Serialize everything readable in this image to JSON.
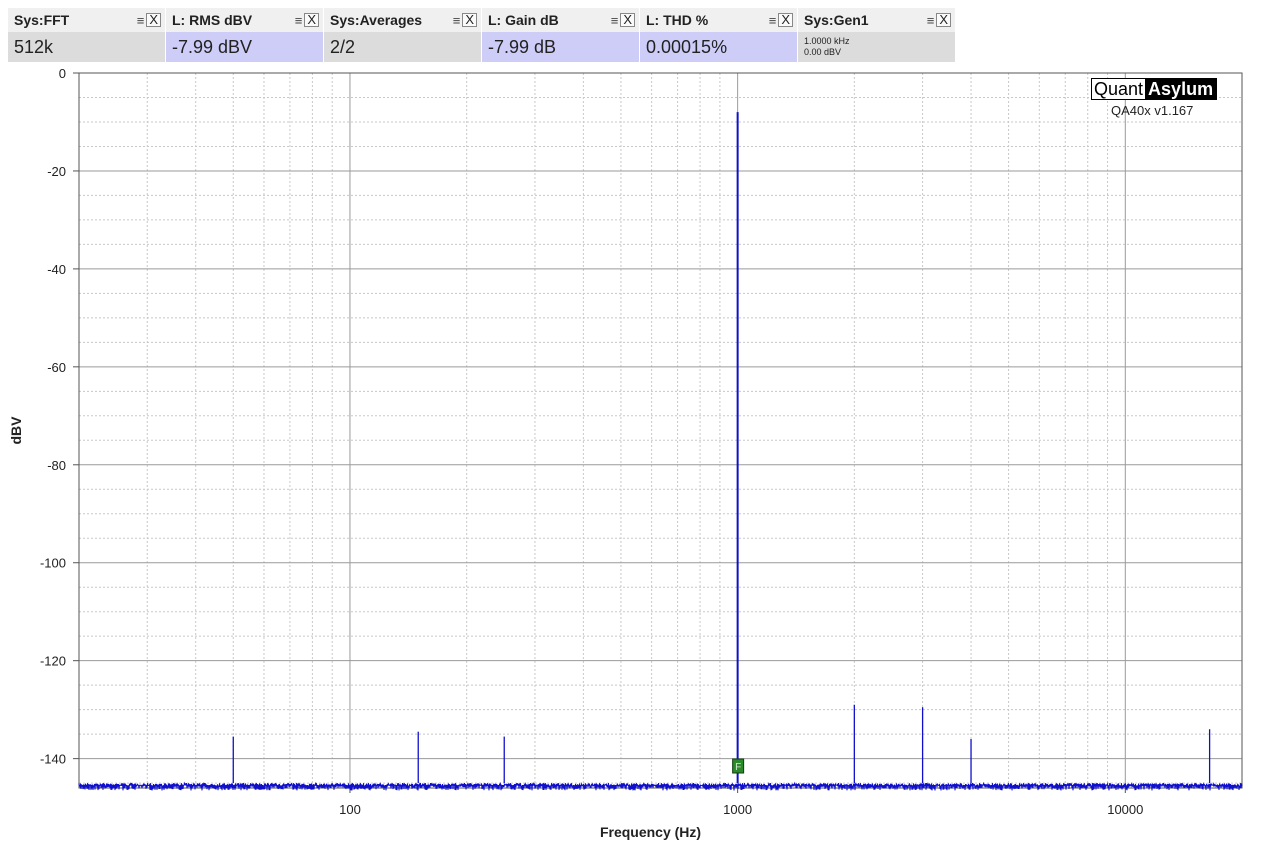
{
  "widgets": [
    {
      "title": "Sys:FFT",
      "value": "512k",
      "highlight": false
    },
    {
      "title": "L: RMS dBV",
      "value": "-7.99 dBV",
      "highlight": true
    },
    {
      "title": "Sys:Averages",
      "value": "2/2",
      "highlight": false
    },
    {
      "title": "L: Gain dB",
      "value": "-7.99 dB",
      "highlight": true
    },
    {
      "title": "L: THD %",
      "value": "0.00015%",
      "highlight": true
    },
    {
      "title": "Sys:Gen1",
      "line1": "1.0000 kHz",
      "line2": "0.00 dBV",
      "highlight": false
    }
  ],
  "controls": {
    "menu_icon": "menu-icon",
    "close_icon": "close-icon",
    "menu_glyph": "≡",
    "close_glyph": "X"
  },
  "brand": {
    "left": "Quant",
    "right": "Asylum",
    "version": "QA40x v1.167"
  },
  "marker": {
    "label": "F"
  },
  "colors": {
    "trace": "#1010cc",
    "grid": "#c8c8c8",
    "marker": "#2a8a2a",
    "widget_value_bg": "#dcdcdc",
    "widget_highlight_bg": "#cdcdf8"
  },
  "chart_data": {
    "type": "line",
    "xlabel": "Frequency (Hz)",
    "ylabel": "dBV",
    "xscale": "log",
    "xlim": [
      20,
      20000
    ],
    "ylim": [
      -146,
      0
    ],
    "xticks": [
      100,
      1000,
      10000
    ],
    "xtick_labels": [
      "100",
      "1000",
      "10000"
    ],
    "yticks": [
      0,
      -20,
      -40,
      -60,
      -80,
      -100,
      -120,
      -140
    ],
    "ytick_labels": [
      "0",
      "-20",
      "-40",
      "-60",
      "-80",
      "-100",
      "-120",
      "-140"
    ],
    "grid": true,
    "noise_floor_dbv": -145,
    "series": [
      {
        "peaks": [
          {
            "x": 1000,
            "y": -8.0
          },
          {
            "x": 50,
            "y": -135.5
          },
          {
            "x": 150,
            "y": -134.5
          },
          {
            "x": 250,
            "y": -135.5
          },
          {
            "x": 2000,
            "y": -129
          },
          {
            "x": 3000,
            "y": -129.5
          },
          {
            "x": 4000,
            "y": -136
          },
          {
            "x": 16500,
            "y": -134
          }
        ],
        "values": [
          [
            20,
            -141
          ],
          [
            25,
            -140
          ],
          [
            30,
            -140.5
          ],
          [
            36,
            -136
          ],
          [
            40,
            -139
          ],
          [
            45,
            -140
          ],
          [
            50,
            -135.5
          ],
          [
            55,
            -141
          ],
          [
            60,
            -140
          ],
          [
            70,
            -141.5
          ],
          [
            80,
            -142
          ],
          [
            90,
            -141
          ],
          [
            100,
            -142
          ],
          [
            120,
            -143
          ],
          [
            150,
            -134.5
          ],
          [
            170,
            -142.5
          ],
          [
            200,
            -143
          ],
          [
            250,
            -135.5
          ],
          [
            300,
            -144
          ],
          [
            400,
            -143.5
          ],
          [
            500,
            -144
          ],
          [
            600,
            -143.5
          ],
          [
            700,
            -144
          ],
          [
            800,
            -144.5
          ],
          [
            900,
            -144
          ],
          [
            950,
            -143
          ],
          [
            990,
            -137
          ],
          [
            995,
            -131
          ],
          [
            1000,
            -8.0
          ],
          [
            1005,
            -131
          ],
          [
            1010,
            -137
          ],
          [
            1050,
            -143
          ],
          [
            1200,
            -144.5
          ],
          [
            1500,
            -144.5
          ],
          [
            2000,
            -129
          ],
          [
            2500,
            -144.5
          ],
          [
            3000,
            -129.5
          ],
          [
            3500,
            -144.5
          ],
          [
            4000,
            -136
          ],
          [
            5000,
            -144.5
          ],
          [
            6000,
            -144
          ],
          [
            8000,
            -143.5
          ],
          [
            10000,
            -143
          ],
          [
            12000,
            -142
          ],
          [
            13000,
            -140
          ],
          [
            14000,
            -138.5
          ],
          [
            15000,
            -138
          ],
          [
            16500,
            -134
          ],
          [
            17500,
            -137
          ],
          [
            18500,
            -135
          ],
          [
            20000,
            -136
          ]
        ]
      }
    ]
  }
}
